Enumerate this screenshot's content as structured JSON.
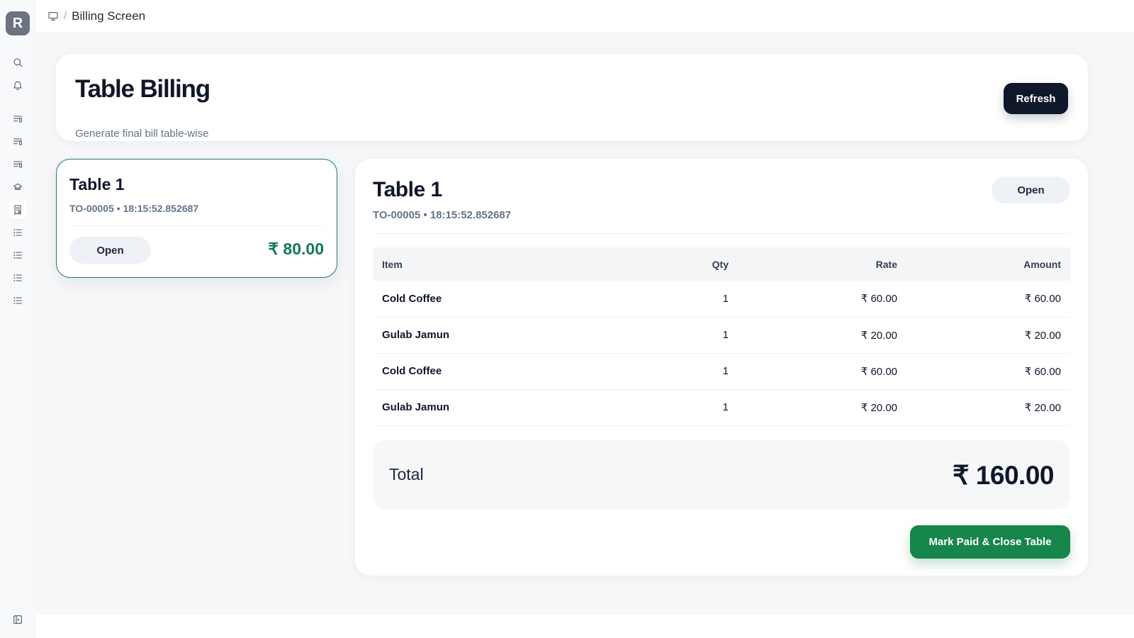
{
  "sidebar": {
    "logo_letter": "R",
    "icons": [
      "search-icon",
      "bell-icon",
      "list-filter-icon",
      "list-filter-icon",
      "list-filter-icon",
      "chef-hat-icon",
      "receipt-icon",
      "list-icon",
      "list-icon",
      "list-icon",
      "list-icon",
      "panel-toggle-icon"
    ]
  },
  "breadcrumb": {
    "icon": "monitor-icon",
    "separator": "/",
    "current": "Billing Screen"
  },
  "header": {
    "title": "Table Billing",
    "subtitle": "Generate final bill table-wise",
    "refresh_label": "Refresh"
  },
  "tables": [
    {
      "name": "Table 1",
      "meta": "TO-00005 • 18:15:52.852687",
      "status": "Open",
      "amount": "₹ 80.00"
    }
  ],
  "bill": {
    "title": "Table 1",
    "meta": "TO-00005 • 18:15:52.852687",
    "status": "Open",
    "columns": [
      "Item",
      "Qty",
      "Rate",
      "Amount"
    ],
    "rows": [
      {
        "item": "Cold Coffee",
        "qty": "1",
        "rate": "₹ 60.00",
        "amount": "₹ 60.00"
      },
      {
        "item": "Gulab Jamun",
        "qty": "1",
        "rate": "₹ 20.00",
        "amount": "₹ 20.00"
      },
      {
        "item": "Cold Coffee",
        "qty": "1",
        "rate": "₹ 60.00",
        "amount": "₹ 60.00"
      },
      {
        "item": "Gulab Jamun",
        "qty": "1",
        "rate": "₹ 20.00",
        "amount": "₹ 20.00"
      }
    ],
    "total_label": "Total",
    "total_value": "₹ 160.00",
    "close_label": "Mark Paid & Close Table"
  },
  "colors": {
    "accent_dark": "#0f172a",
    "success": "#16864a",
    "amount_green": "#0f7a5c",
    "selected_border": "#1f7a6d"
  }
}
